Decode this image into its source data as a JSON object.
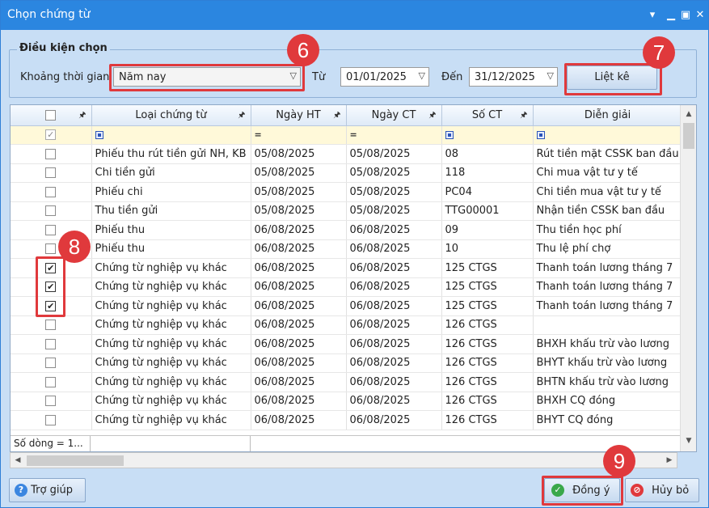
{
  "window": {
    "title": "Chọn chứng từ"
  },
  "filter": {
    "legend": "Điều kiện chọn",
    "period_label": "Khoảng thời gian",
    "period_value": "Năm nay",
    "from_label": "Từ",
    "from_value": "01/01/2025",
    "to_label": "Đến",
    "to_value": "31/12/2025",
    "list_button": "Liệt kê"
  },
  "grid": {
    "columns": [
      "Loại chứng từ",
      "Ngày HT",
      "Ngày CT",
      "Số CT",
      "Diễn giải"
    ],
    "rows": [
      {
        "type": "Phiếu thu rút tiền gửi NH, KB",
        "date_ht": "05/08/2025",
        "date_ct": "05/08/2025",
        "no": "08",
        "desc": "Rút tiền mặt CSSK ban đầu",
        "checked": false
      },
      {
        "type": "Chi tiền gửi",
        "date_ht": "05/08/2025",
        "date_ct": "05/08/2025",
        "no": "118",
        "desc": "Chi mua vật tư y tế",
        "checked": false
      },
      {
        "type": "Phiếu chi",
        "date_ht": "05/08/2025",
        "date_ct": "05/08/2025",
        "no": "PC04",
        "desc": "Chi tiền mua vật tư y tế",
        "checked": false
      },
      {
        "type": "Thu tiền gửi",
        "date_ht": "05/08/2025",
        "date_ct": "05/08/2025",
        "no": "TTG00001",
        "desc": "Nhận tiền CSSK ban đầu",
        "checked": false
      },
      {
        "type": "Phiếu thu",
        "date_ht": "06/08/2025",
        "date_ct": "06/08/2025",
        "no": "09",
        "desc": "Thu tiền học phí",
        "checked": false
      },
      {
        "type": "Phiếu thu",
        "date_ht": "06/08/2025",
        "date_ct": "06/08/2025",
        "no": "10",
        "desc": "Thu lệ phí chợ",
        "checked": false
      },
      {
        "type": "Chứng từ nghiệp vụ khác",
        "date_ht": "06/08/2025",
        "date_ct": "06/08/2025",
        "no": "125 CTGS",
        "desc": "Thanh toán lương tháng 7",
        "checked": true
      },
      {
        "type": "Chứng từ nghiệp vụ khác",
        "date_ht": "06/08/2025",
        "date_ct": "06/08/2025",
        "no": "125 CTGS",
        "desc": "Thanh toán lương tháng 7",
        "checked": true
      },
      {
        "type": "Chứng từ nghiệp vụ khác",
        "date_ht": "06/08/2025",
        "date_ct": "06/08/2025",
        "no": "125 CTGS",
        "desc": "Thanh toán lương tháng 7",
        "checked": true
      },
      {
        "type": "Chứng từ nghiệp vụ khác",
        "date_ht": "06/08/2025",
        "date_ct": "06/08/2025",
        "no": "126 CTGS",
        "desc": "",
        "checked": false
      },
      {
        "type": "Chứng từ nghiệp vụ khác",
        "date_ht": "06/08/2025",
        "date_ct": "06/08/2025",
        "no": "126 CTGS",
        "desc": "BHXH khấu trừ vào lương",
        "checked": false
      },
      {
        "type": "Chứng từ nghiệp vụ khác",
        "date_ht": "06/08/2025",
        "date_ct": "06/08/2025",
        "no": "126 CTGS",
        "desc": "BHYT khấu trừ vào lương",
        "checked": false
      },
      {
        "type": "Chứng từ nghiệp vụ khác",
        "date_ht": "06/08/2025",
        "date_ct": "06/08/2025",
        "no": "126 CTGS",
        "desc": "BHTN khấu trừ vào lương",
        "checked": false
      },
      {
        "type": "Chứng từ nghiệp vụ khác",
        "date_ht": "06/08/2025",
        "date_ct": "06/08/2025",
        "no": "126 CTGS",
        "desc": "BHXH CQ đóng",
        "checked": false
      },
      {
        "type": "Chứng từ nghiệp vụ khác",
        "date_ht": "06/08/2025",
        "date_ct": "06/08/2025",
        "no": "126 CTGS",
        "desc": "BHYT CQ đóng",
        "checked": false
      }
    ],
    "row_count_text": "Số dòng = 1..."
  },
  "buttons": {
    "help": "Trợ giúp",
    "ok": "Đồng ý",
    "cancel": "Hủy bỏ"
  },
  "annotations": [
    "6",
    "7",
    "8",
    "9"
  ],
  "colors": {
    "titlebar": "#2b86e0",
    "highlight": "#e0393c",
    "filter_row": "#fff9d9"
  }
}
